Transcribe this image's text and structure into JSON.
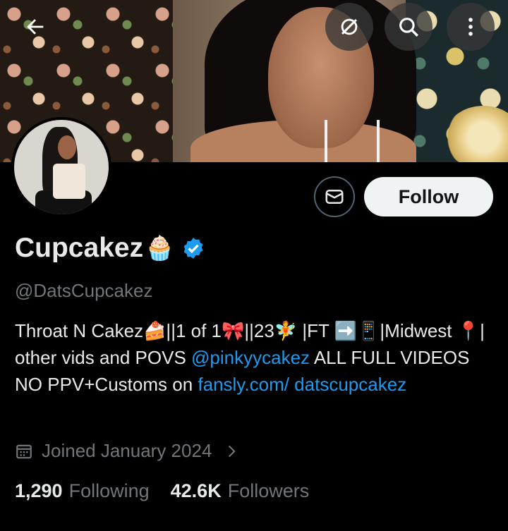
{
  "header": {
    "back_icon": "arrow-left-icon",
    "grok_icon": "grok-icon",
    "search_icon": "search-icon",
    "more_icon": "more-vertical-icon"
  },
  "profile": {
    "name": "Cupcakez",
    "name_emoji": "🧁",
    "verified": true,
    "verified_color": "#1d9bf0",
    "handle": "@DatsCupcakez",
    "follow_label": "Follow",
    "bio": {
      "part1": "Throat N Cakez🍰||1 of 1🎀||23🧚 |FT ➡️📱|Midwest 📍| other vids and POVS ",
      "mention": "@pinkyycakez",
      "part2": " ALL FULL VIDEOS NO PPV+Customs on ",
      "link": "fansly.com/ datscupcakez"
    },
    "joined": "Joined January 2024",
    "following_count": "1,290",
    "following_label": "Following",
    "followers_count": "42.6K",
    "followers_label": "Followers"
  },
  "colors": {
    "background": "#000000",
    "text_primary": "#e7e9ea",
    "text_secondary": "#71767b",
    "link": "#1d9bf0",
    "follow_bg": "#eff3f4"
  }
}
